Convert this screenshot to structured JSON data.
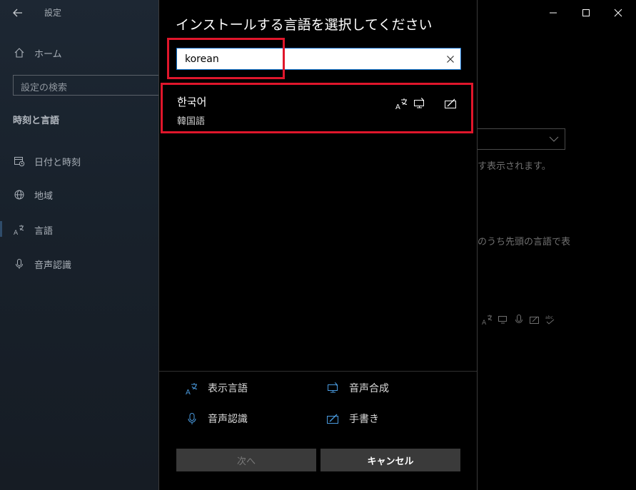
{
  "settings": {
    "title": "設定",
    "home": "ホーム",
    "search_placeholder": "設定の検索",
    "section": "時刻と言語",
    "nav": [
      {
        "label": "日付と時刻",
        "icon": "calendar-clock-icon"
      },
      {
        "label": "地域",
        "icon": "globe-icon"
      },
      {
        "label": "言語",
        "icon": "language-icon"
      },
      {
        "label": "音声認識",
        "icon": "microphone-icon"
      }
    ],
    "main_fragments": [
      "す表示されます。",
      "のうち先頭の言語で表"
    ]
  },
  "dialog": {
    "title": "インストールする言語を選択してください",
    "search_value": "korean",
    "result": {
      "native_name": "한국어",
      "local_name": "韓国語"
    },
    "legend": {
      "display_language": "表示言語",
      "speech_synthesis": "音声合成",
      "speech_recognition": "音声認識",
      "handwriting": "手書き"
    },
    "buttons": {
      "next": "次へ",
      "cancel": "キャンセル"
    }
  },
  "colors": {
    "highlight": "#e0162b",
    "accent": "#0a6ec9"
  }
}
